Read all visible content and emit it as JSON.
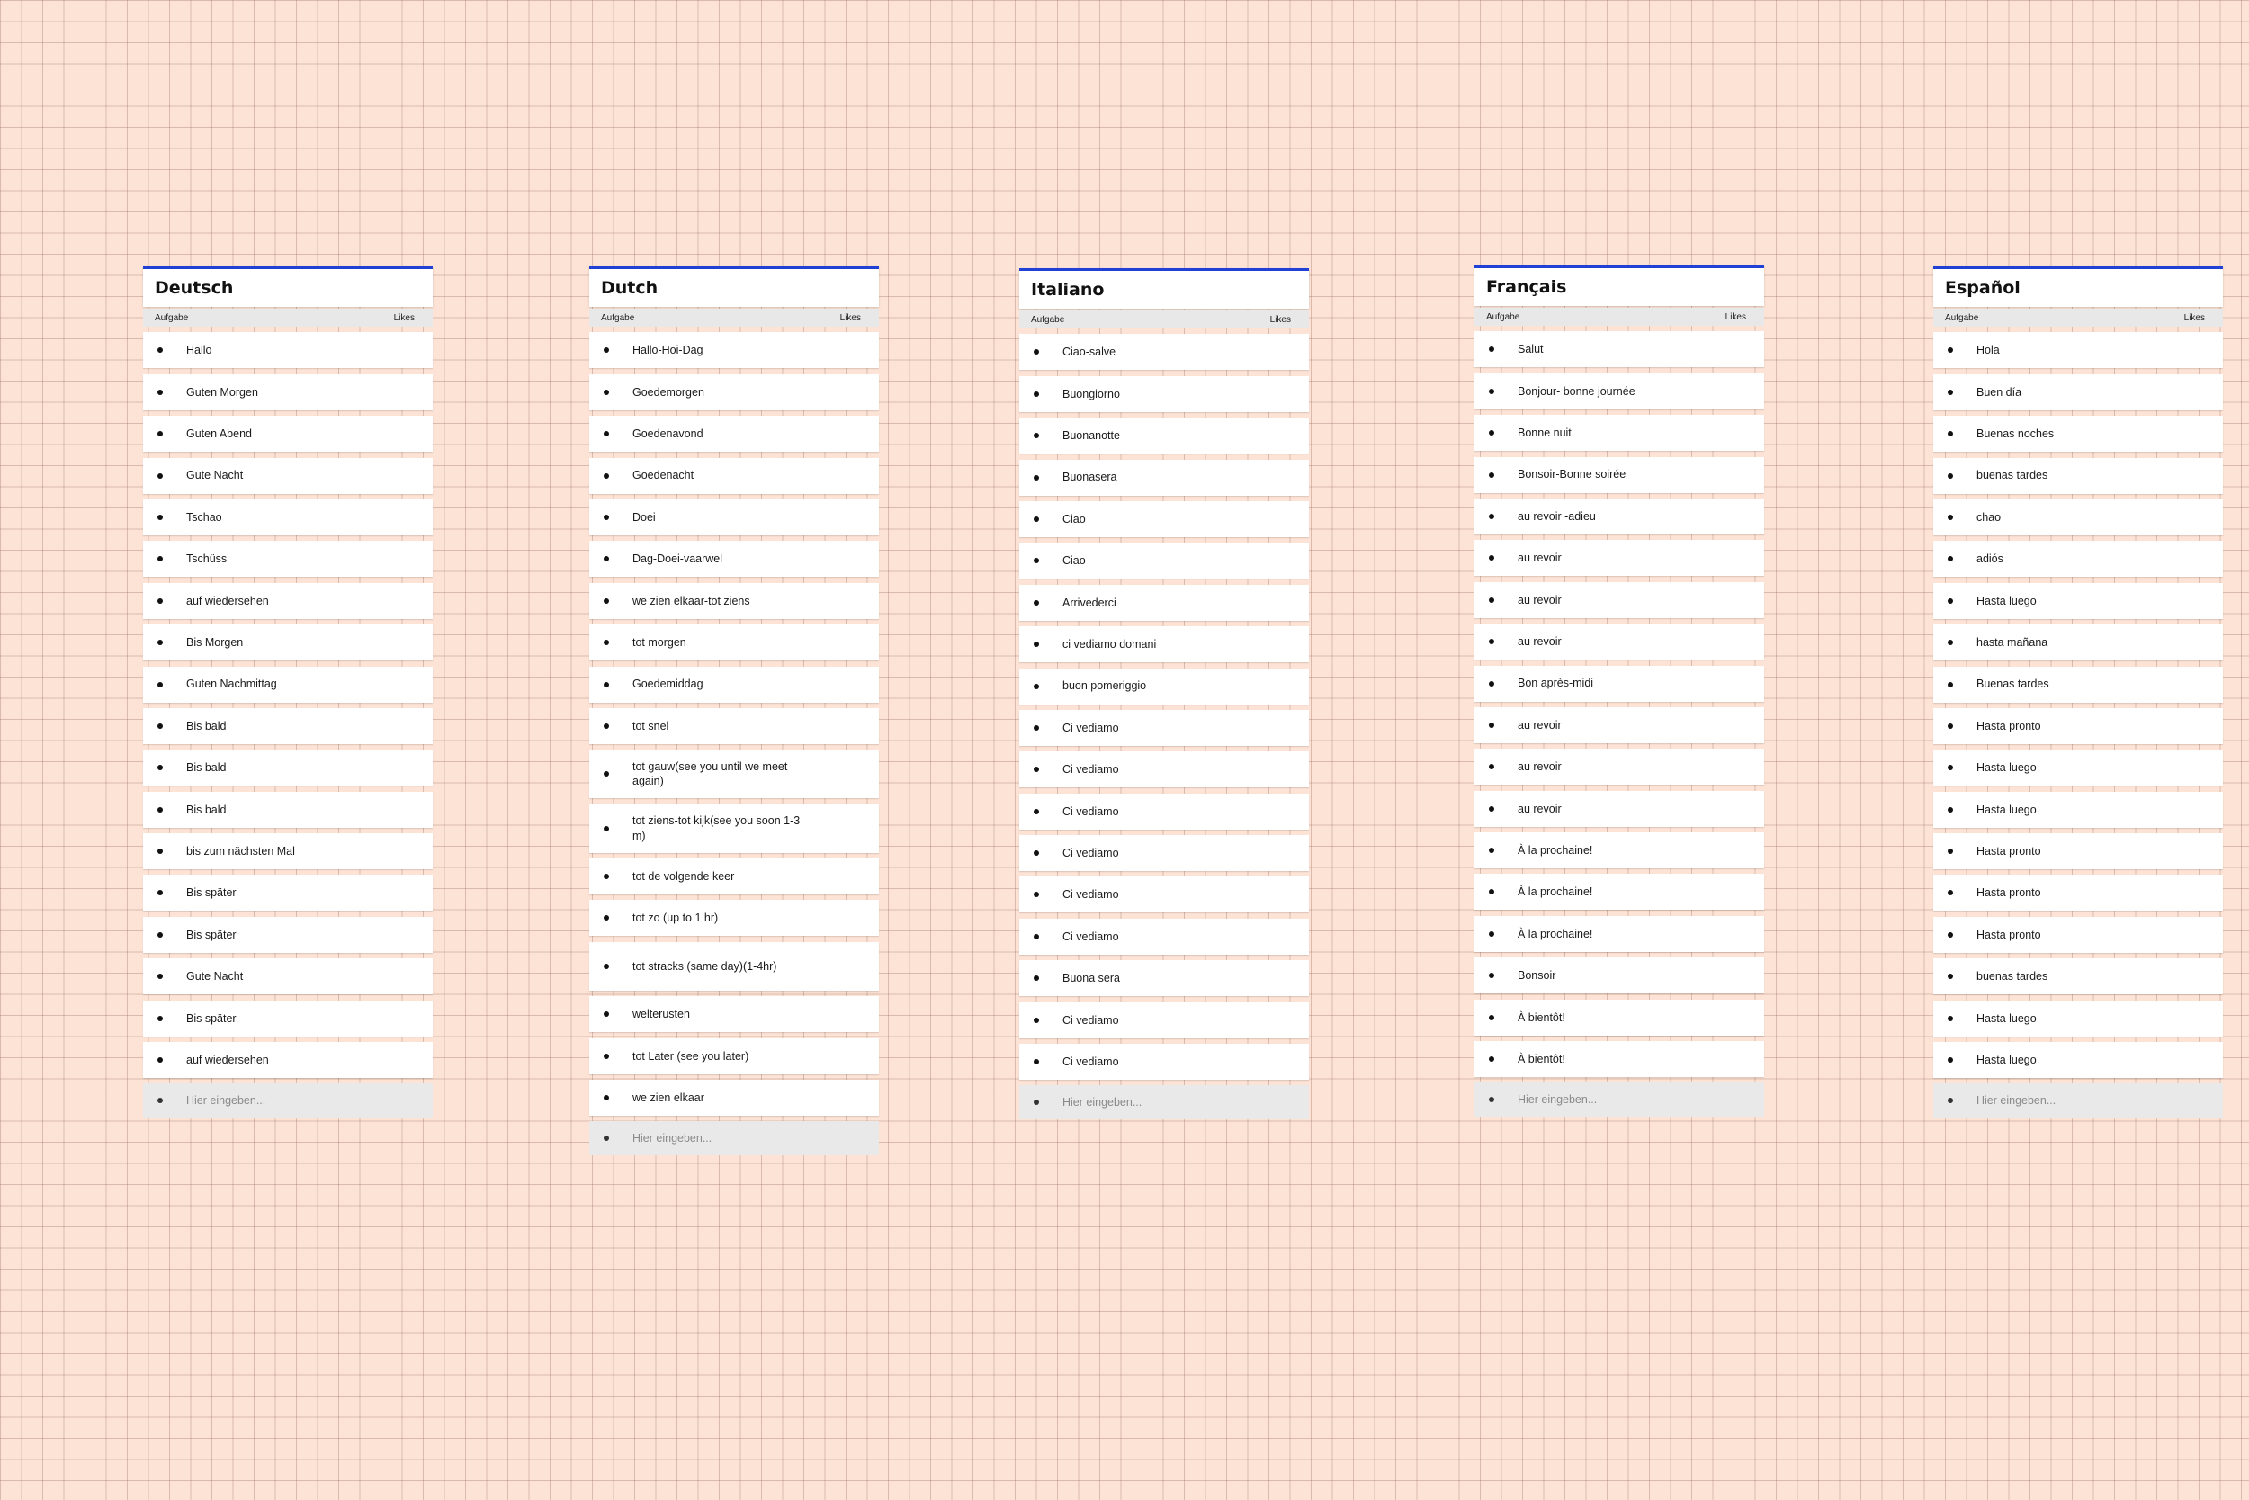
{
  "column_labels": {
    "task": "Aufgabe",
    "likes": "Likes"
  },
  "input_placeholder": "Hier eingeben...",
  "accent_color": "#2141d6",
  "boards": [
    {
      "title": "Deutsch",
      "items": [
        "Hallo",
        "Guten Morgen",
        "Guten Abend",
        "Gute Nacht",
        "Tschao",
        "Tschüss",
        "auf wiedersehen",
        "Bis Morgen",
        "Guten Nachmittag",
        "Bis bald",
        "Bis bald",
        "Bis bald",
        "bis zum nächsten Mal",
        "Bis später",
        "Bis später",
        "Gute Nacht",
        "Bis später",
        "auf wiedersehen"
      ]
    },
    {
      "title": "Dutch",
      "items": [
        "Hallo-Hoi-Dag",
        "Goedemorgen",
        "Goedenavond",
        "Goedenacht",
        "Doei",
        "Dag-Doei-vaarwel",
        "we zien elkaar-tot ziens",
        "tot morgen",
        "Goedemiddag",
        "tot snel",
        "tot gauw(see you until we meet again)",
        "tot ziens-tot kijk(see you soon 1-3 m)",
        "tot de volgende keer",
        "tot zo (up to 1 hr)",
        "tot stracks (same day)(1-4hr)",
        "welterusten",
        "tot Later (see you later)",
        "we zien elkaar"
      ]
    },
    {
      "title": "Italiano",
      "items": [
        "Ciao-salve",
        "Buongiorno",
        "Buonanotte",
        "Buonasera",
        "Ciao",
        "Ciao",
        "Arrivederci",
        "ci vediamo domani",
        "buon pomeriggio",
        "Ci vediamo",
        "Ci vediamo",
        "Ci vediamo",
        "Ci vediamo",
        "Ci vediamo",
        "Ci vediamo",
        "Buona sera",
        "Ci vediamo",
        "Ci vediamo"
      ]
    },
    {
      "title": "Français",
      "items": [
        "Salut",
        "Bonjour- bonne journée",
        "Bonne nuit",
        "Bonsoir-Bonne soirée",
        "au revoir -adieu",
        "au revoir",
        "au revoir",
        "au revoir",
        "Bon après-midi",
        "au revoir",
        "au revoir",
        "au revoir",
        "À la prochaine!",
        "À la prochaine!",
        "À la prochaine!",
        "Bonsoir",
        "À bientôt!",
        "À bientôt!"
      ]
    },
    {
      "title": "Español",
      "items": [
        "Hola",
        "Buen día",
        "Buenas noches",
        "buenas tardes",
        "chao",
        "adiós",
        "Hasta luego",
        "hasta mañana",
        "Buenas tardes",
        "Hasta pronto",
        "Hasta luego",
        "Hasta luego",
        "Hasta pronto",
        "Hasta pronto",
        "Hasta pronto",
        "buenas tardes",
        "Hasta luego",
        "Hasta luego"
      ]
    }
  ]
}
